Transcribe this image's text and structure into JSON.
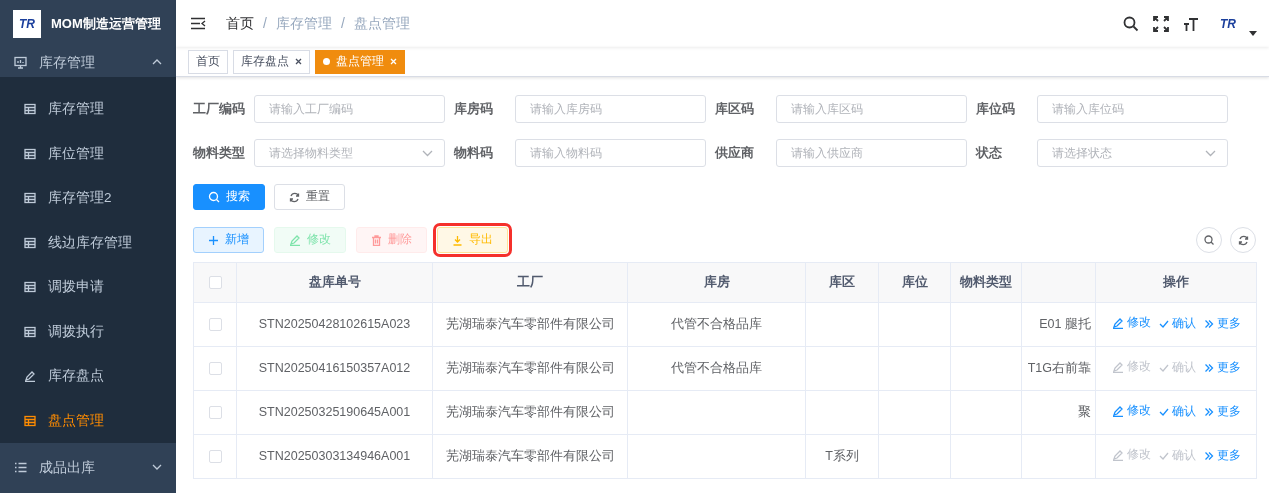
{
  "sidebar": {
    "brand_mark": "TR",
    "title": "MOM制造运营管理",
    "menus": [
      {
        "label": "库存管理",
        "kind": "monitor",
        "expanded": true,
        "children": [
          {
            "label": "库存管理",
            "kind": "table",
            "selected": false
          },
          {
            "label": "库位管理",
            "kind": "table",
            "selected": false
          },
          {
            "label": "库存管理2",
            "kind": "table",
            "selected": false
          },
          {
            "label": "线边库存管理",
            "kind": "table",
            "selected": false
          },
          {
            "label": "调拨申请",
            "kind": "table",
            "selected": false
          },
          {
            "label": "调拨执行",
            "kind": "table",
            "selected": false
          },
          {
            "label": "库存盘点",
            "kind": "edit",
            "selected": false
          },
          {
            "label": "盘点管理",
            "kind": "table",
            "selected": true
          }
        ]
      },
      {
        "label": "成品出库",
        "kind": "list",
        "expanded": false
      }
    ]
  },
  "header": {
    "breadcrumb": [
      "首页",
      "库存管理",
      "盘点管理"
    ],
    "breadcrumb_separator": "/",
    "brand_mark": "TR"
  },
  "tags": [
    {
      "label": "首页",
      "closable": false,
      "selected": false
    },
    {
      "label": "库存盘点",
      "closable": true,
      "selected": false
    },
    {
      "label": "盘点管理",
      "closable": true,
      "selected": true
    }
  ],
  "filters": [
    {
      "label": "工厂编码",
      "placeholder": "请输入工厂编码",
      "kind": "input"
    },
    {
      "label": "库房码",
      "placeholder": "请输入库房码",
      "kind": "input"
    },
    {
      "label": "库区码",
      "placeholder": "请输入库区码",
      "kind": "input"
    },
    {
      "label": "库位码",
      "placeholder": "请输入库位码",
      "kind": "input"
    },
    {
      "label": "物料类型",
      "placeholder": "请选择物料类型",
      "kind": "select"
    },
    {
      "label": "物料码",
      "placeholder": "请输入物料码",
      "kind": "input"
    },
    {
      "label": "供应商",
      "placeholder": "请输入供应商",
      "kind": "input"
    },
    {
      "label": "状态",
      "placeholder": "请选择状态",
      "kind": "select"
    }
  ],
  "search_buttons": [
    {
      "label": "搜索",
      "kind": "search"
    },
    {
      "label": "重置",
      "kind": "reset"
    }
  ],
  "toolbar": [
    {
      "label": "新增",
      "kind": "add",
      "disabled": false,
      "highlighted": false
    },
    {
      "label": "修改",
      "kind": "edit",
      "disabled": true,
      "highlighted": false
    },
    {
      "label": "删除",
      "kind": "delete",
      "disabled": true,
      "highlighted": false
    },
    {
      "label": "导出",
      "kind": "export",
      "disabled": false,
      "highlighted": true
    }
  ],
  "table": {
    "columns": [
      "盘库单号",
      "工厂",
      "库房",
      "库区",
      "库位",
      "物料类型",
      "",
      "操作"
    ],
    "all_checked": false,
    "rows": [
      {
        "checked": false,
        "cells": [
          "STN20250428102615A023",
          "芜湖瑞泰汽车零部件有限公司",
          "代管不合格品库",
          "",
          "",
          "",
          "E01 腿托"
        ],
        "actions": [
          {
            "label": "修改",
            "kind": "edit",
            "disabled": false
          },
          {
            "label": "确认",
            "kind": "confirm",
            "disabled": false
          },
          {
            "label": "更多",
            "kind": "more",
            "disabled": false
          }
        ]
      },
      {
        "checked": false,
        "cells": [
          "STN20250416150357A012",
          "芜湖瑞泰汽车零部件有限公司",
          "代管不合格品库",
          "",
          "",
          "",
          "T1G右前靠"
        ],
        "actions": [
          {
            "label": "修改",
            "kind": "edit",
            "disabled": true
          },
          {
            "label": "确认",
            "kind": "confirm",
            "disabled": true
          },
          {
            "label": "更多",
            "kind": "more",
            "disabled": false
          }
        ]
      },
      {
        "checked": false,
        "cells": [
          "STN20250325190645A001",
          "芜湖瑞泰汽车零部件有限公司",
          "",
          "",
          "",
          "",
          "聚"
        ],
        "actions": [
          {
            "label": "修改",
            "kind": "edit",
            "disabled": false
          },
          {
            "label": "确认",
            "kind": "confirm",
            "disabled": false
          },
          {
            "label": "更多",
            "kind": "more",
            "disabled": false
          }
        ]
      },
      {
        "checked": false,
        "cells": [
          "STN20250303134946A001",
          "芜湖瑞泰汽车零部件有限公司",
          "",
          "T系列",
          "",
          "",
          ""
        ],
        "actions": [
          {
            "label": "修改",
            "kind": "edit",
            "disabled": true
          },
          {
            "label": "确认",
            "kind": "confirm",
            "disabled": true
          },
          {
            "label": "更多",
            "kind": "more",
            "disabled": false
          }
        ]
      }
    ]
  }
}
